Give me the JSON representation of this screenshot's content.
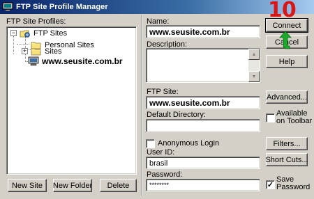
{
  "window": {
    "title": "FTP Site Profile Manager",
    "app_icon": "ftp-app-icon"
  },
  "annotation": {
    "step_number": "10",
    "color": "#d81818",
    "arrow_color": "#1ca82a"
  },
  "profiles": {
    "label": "FTP Site Profiles:",
    "tree": [
      {
        "label": "FTP Sites",
        "icon": "root-folder-icon",
        "expander": "−"
      },
      {
        "label": "Personal Sites",
        "icon": "folder-icon"
      },
      {
        "label": "Sites",
        "icon": "folder-icon",
        "expander": "+"
      },
      {
        "label": "www.seusite.com.br",
        "icon": "computer-icon",
        "selected": true
      }
    ],
    "buttons": {
      "new_site": "New Site",
      "new_folder": "New Folder",
      "delete": "Delete"
    }
  },
  "form": {
    "name_label": "Name:",
    "name_value": "www.seusite.com.br",
    "description_label": "Description:",
    "description_value": "",
    "ftp_site_label": "FTP Site:",
    "ftp_site_value": "www.seusite.com.br",
    "default_dir_label": "Default Directory:",
    "default_dir_value": "",
    "anonymous_label": "Anonymous Login",
    "anonymous_checked": false,
    "userid_label": "User ID:",
    "userid_value": "brasil",
    "password_label": "Password:",
    "password_value": "********",
    "available_toolbar_label_1": "Available",
    "available_toolbar_label_2": "on Toolbar",
    "available_toolbar_checked": false,
    "save_password_label_1": "Save",
    "save_password_label_2": "Password",
    "save_password_checked": true
  },
  "buttons": {
    "connect": "Connect",
    "cancel": "Cancel",
    "help": "Help",
    "advanced": "Advanced...",
    "filters": "Filters...",
    "shortcuts": "Short Cuts..."
  }
}
